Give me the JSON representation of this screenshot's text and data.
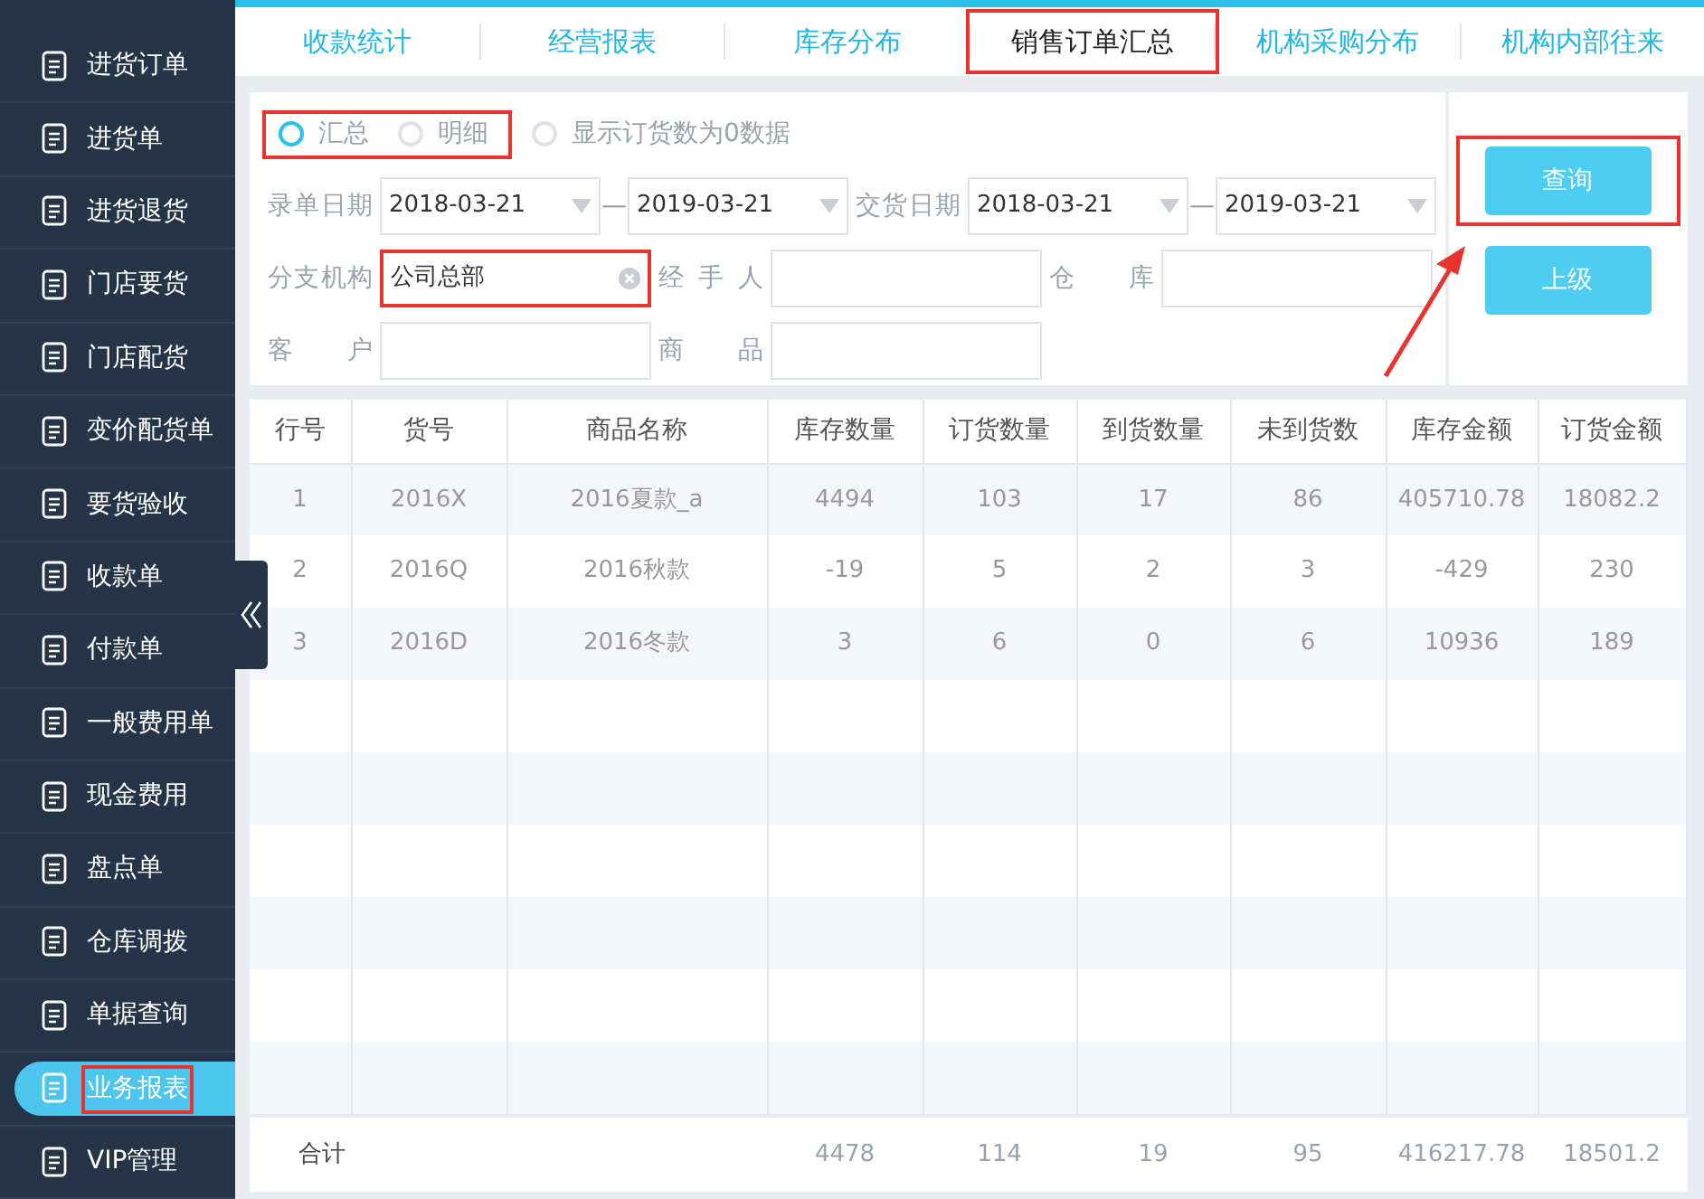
{
  "sidebar": {
    "items": [
      {
        "label": "进货订单",
        "selected": false,
        "highlighted": false
      },
      {
        "label": "进货单",
        "selected": false,
        "highlighted": false
      },
      {
        "label": "进货退货",
        "selected": false,
        "highlighted": false
      },
      {
        "label": "门店要货",
        "selected": false,
        "highlighted": false
      },
      {
        "label": "门店配货",
        "selected": false,
        "highlighted": false
      },
      {
        "label": "变价配货单",
        "selected": false,
        "highlighted": false
      },
      {
        "label": "要货验收",
        "selected": false,
        "highlighted": false
      },
      {
        "label": "收款单",
        "selected": false,
        "highlighted": false
      },
      {
        "label": "付款单",
        "selected": false,
        "highlighted": false
      },
      {
        "label": "一般费用单",
        "selected": false,
        "highlighted": false
      },
      {
        "label": "现金费用",
        "selected": false,
        "highlighted": false
      },
      {
        "label": "盘点单",
        "selected": false,
        "highlighted": false
      },
      {
        "label": "仓库调拨",
        "selected": false,
        "highlighted": false
      },
      {
        "label": "单据查询",
        "selected": false,
        "highlighted": false
      },
      {
        "label": "业务报表",
        "selected": true,
        "highlighted": true
      },
      {
        "label": "VIP管理",
        "selected": false,
        "highlighted": false
      }
    ]
  },
  "tabs": [
    {
      "label": "收款统计",
      "selected": false,
      "highlighted": false
    },
    {
      "label": "经营报表",
      "selected": false,
      "highlighted": false
    },
    {
      "label": "库存分布",
      "selected": false,
      "highlighted": false
    },
    {
      "label": "销售订单汇总",
      "selected": true,
      "highlighted": true
    },
    {
      "label": "机构采购分布",
      "selected": false,
      "highlighted": false
    },
    {
      "label": "机构内部往来",
      "selected": false,
      "highlighted": false
    }
  ],
  "filters": {
    "mode": {
      "highlighted": true,
      "options": [
        {
          "label": "汇总",
          "selected": true
        },
        {
          "label": "明细",
          "selected": false
        }
      ]
    },
    "show_zero": {
      "label": "显示订货数为0数据",
      "checked": false
    },
    "date_ranges": [
      {
        "label": "录单日期",
        "from": "2018-03-21",
        "separator": "—",
        "to": "2019-03-21"
      },
      {
        "label": "交货日期",
        "from": "2018-03-21",
        "separator": "—",
        "to": "2019-03-21"
      }
    ],
    "fields": [
      {
        "label": "分支机构",
        "value": "公司总部",
        "clearable": true,
        "highlighted": true
      },
      {
        "label": "经 手 人",
        "clearable": false,
        "highlighted": false
      },
      {
        "label": "仓 库",
        "clearable": false,
        "highlighted": false
      },
      {
        "label": "客 户",
        "clearable": false,
        "highlighted": false
      },
      {
        "label": "商 品",
        "clearable": false,
        "highlighted": false
      }
    ],
    "buttons": [
      {
        "label": "查询",
        "highlighted": true
      },
      {
        "label": "上级",
        "highlighted": false
      }
    ]
  },
  "table": {
    "columns": [
      "行号",
      "货号",
      "商品名称",
      "库存数量",
      "订货数量",
      "到货数量",
      "未到货数",
      "库存金额",
      "订货金额"
    ],
    "rows": [
      [
        "1",
        "2016X",
        "2016夏款_a",
        "4494",
        "103",
        "17",
        "86",
        "405710.78",
        "18082.2"
      ],
      [
        "2",
        "2016Q",
        "2016秋款",
        "-19",
        "5",
        "2",
        "3",
        "-429",
        "230"
      ],
      [
        "3",
        "2016D",
        "2016冬款",
        "3",
        "6",
        "0",
        "6",
        "10936",
        "189"
      ]
    ],
    "totals": {
      "label": "合计",
      "values": [
        "4478",
        "114",
        "19",
        "95",
        "416217.78",
        "18501.2"
      ]
    }
  },
  "annotations": [
    {
      "kind": "arrow"
    }
  ]
}
